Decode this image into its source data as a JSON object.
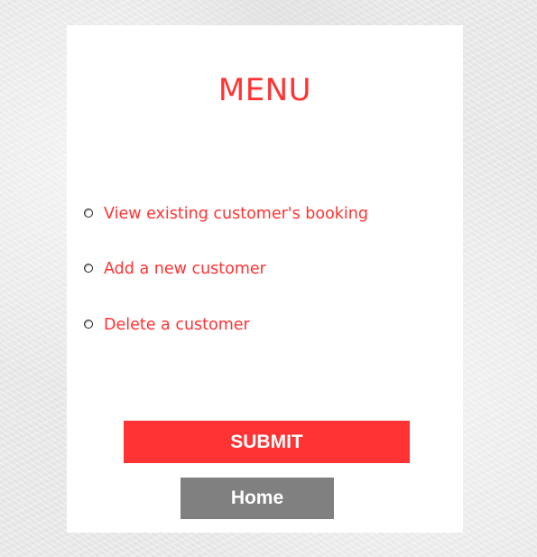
{
  "menu": {
    "title": "MENU",
    "options": [
      {
        "label": "View existing customer's booking",
        "selected": false
      },
      {
        "label": "Add a new customer",
        "selected": false
      },
      {
        "label": "Delete a customer",
        "selected": false
      }
    ]
  },
  "actions": {
    "submit_label": "SUBMIT",
    "home_label": "Home"
  },
  "colors": {
    "accent": "#ff3333",
    "home_button": "#808080",
    "panel": "#ffffff"
  }
}
